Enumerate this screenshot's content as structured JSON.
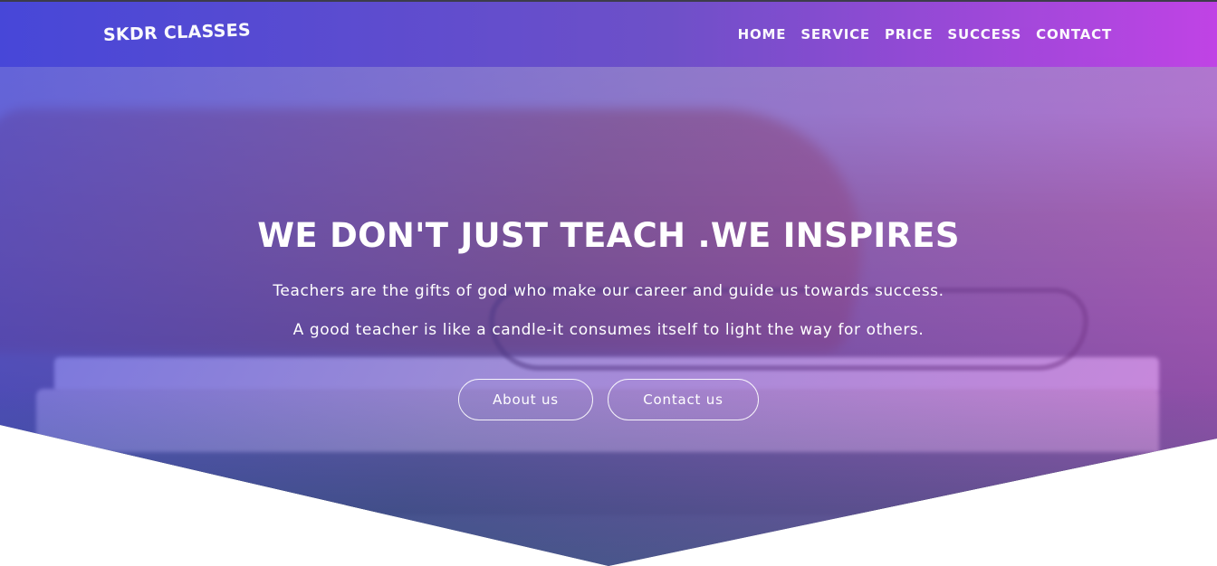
{
  "header": {
    "logo": "SKDR CLASSES",
    "nav": [
      "HOME",
      "SERVICE",
      "PRICE",
      "SUCCESS",
      "CONTACT"
    ]
  },
  "hero": {
    "title": "WE DON'T JUST TEACH .WE INSPIRES",
    "line1": "Teachers are the gifts of god who make our career and guide us towards success.",
    "line2": "A good teacher is like a candle-it consumes itself to light the way for others.",
    "buttons": {
      "about": "About us",
      "contact": "Contact us"
    }
  },
  "colors": {
    "header_gradient_start": "#4646d8",
    "header_gradient_end": "#c141e6",
    "text": "#ffffff"
  }
}
